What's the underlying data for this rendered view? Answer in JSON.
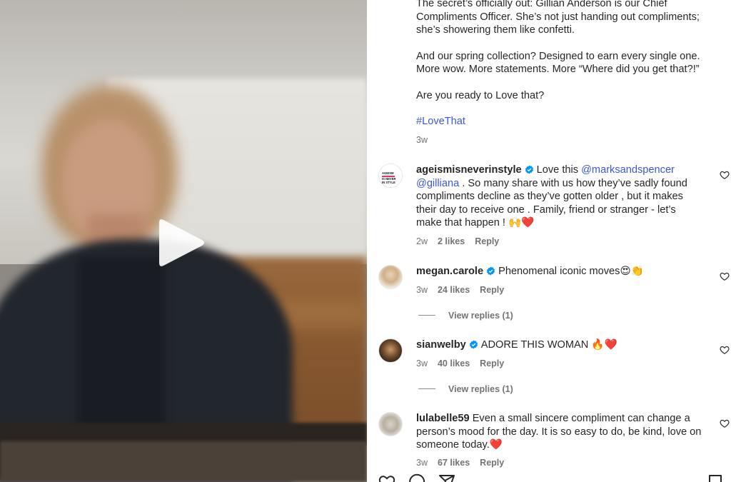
{
  "caption": {
    "para1": "The secret’s officially out: Gillian Anderson is our Chief Compliments Officer. She’s not just handing out compliments; she’s showering them like confetti.",
    "para2": "And our spring collection? Designed to earn every single one. More wow. More statements. More “Where did you get that?!”",
    "para3": "Are you ready to Love that?",
    "hashtag": "#LoveThat",
    "time": "3w"
  },
  "comments": [
    {
      "username": "ageismisneverinstyle",
      "avatar_text": "AGEISM IS NEVER IN STYLE",
      "text_before": "Love this ",
      "mention1": "@marksandspencer",
      "mention2": "@gilliana",
      "text_after": " . So many share with us how they’ve sadly found compliments decline as they’ve gotten older , but it makes their day to receive one . Family, friend or stranger - let’s make that happen ! 🙌❤️",
      "time": "2w",
      "likes": "2 likes",
      "reply": "Reply"
    },
    {
      "username": "megan.carole",
      "text": "Phenomenal iconic moves😍👏",
      "time": "3w",
      "likes": "24 likes",
      "reply": "Reply",
      "view_replies": "View replies (1)"
    },
    {
      "username": "sianwelby",
      "text": "ADORE THIS WOMAN 🔥❤️",
      "time": "3w",
      "likes": "40 likes",
      "reply": "Reply",
      "view_replies": "View replies (1)"
    },
    {
      "username": "lulabelle59",
      "text": "Even a small sincere compliment can change a person’s mood for the day. It is so easy to do, be kind, love on someone today.❤️",
      "time": "3w",
      "likes": "67 likes",
      "reply": "Reply"
    }
  ],
  "icons": {
    "play": "play-icon",
    "verified": "verified-badge-icon",
    "heart": "heart-outline-icon",
    "like": "like-icon",
    "comment": "comment-icon",
    "share": "share-icon",
    "save": "bookmark-icon"
  },
  "colors": {
    "link": "#3b57d7",
    "verified": "#0095f6",
    "muted": "#737373",
    "text": "#262626"
  }
}
